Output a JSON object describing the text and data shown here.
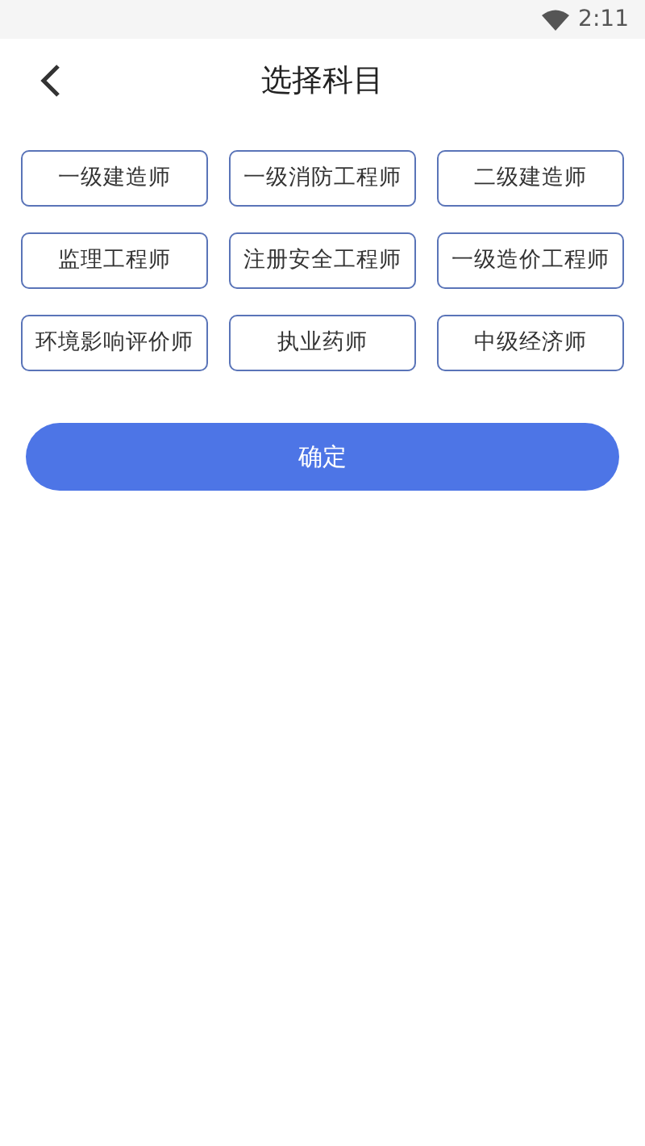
{
  "status_bar": {
    "time": "2:11"
  },
  "header": {
    "title": "选择科目"
  },
  "subjects": [
    {
      "label": "一级建造师",
      "selected": false
    },
    {
      "label": "一级消防工程师",
      "selected": false
    },
    {
      "label": "二级建造师",
      "selected": false
    },
    {
      "label": "监理工程师",
      "selected": false
    },
    {
      "label": "注册安全工程师",
      "selected": false
    },
    {
      "label": "一级造价工程师",
      "selected": false
    },
    {
      "label": "环境影响评价师",
      "selected": false
    },
    {
      "label": "执业药师",
      "selected": false
    },
    {
      "label": "中级经济师",
      "selected": false
    }
  ],
  "confirm_button": "确定"
}
